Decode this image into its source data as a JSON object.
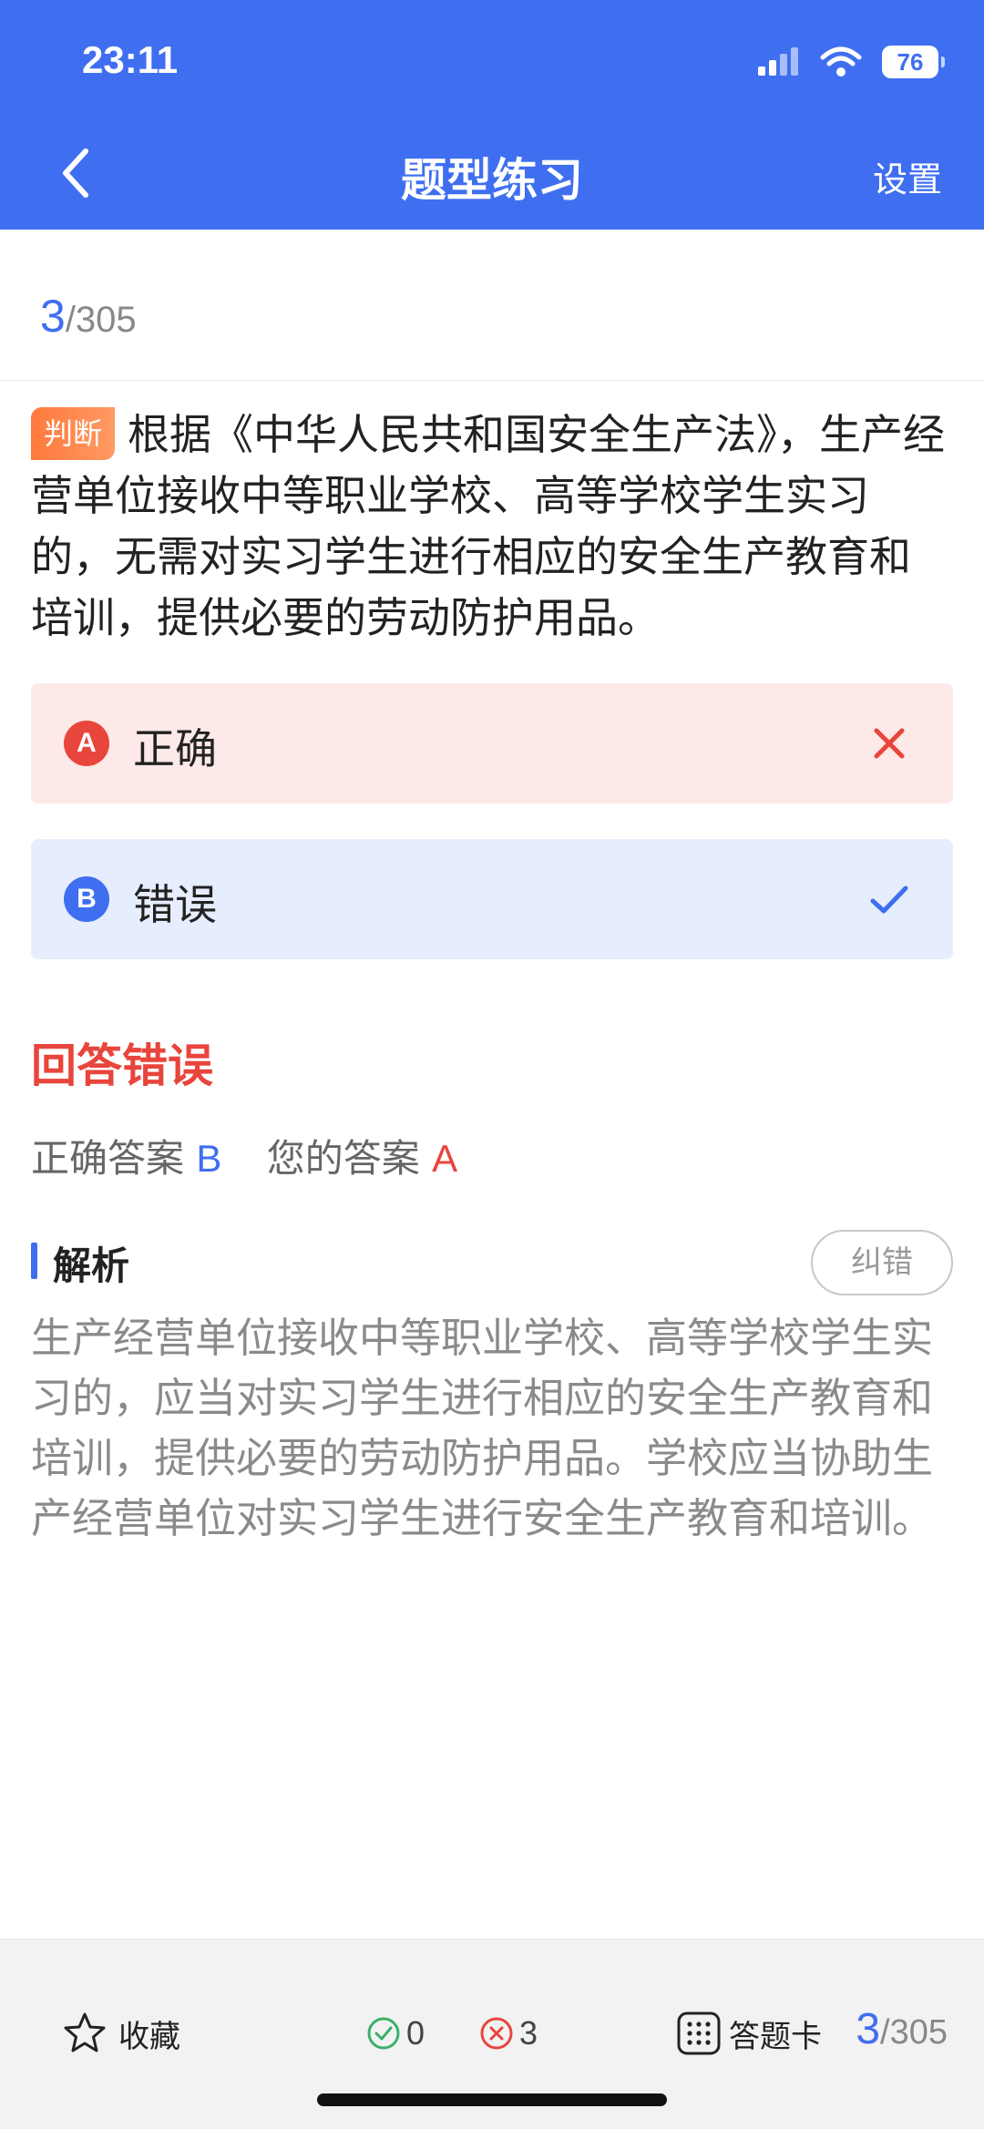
{
  "status_bar": {
    "time": "23:11",
    "battery": "76"
  },
  "nav": {
    "title": "题型练习",
    "settings_label": "设置"
  },
  "progress": {
    "current": "3",
    "total": "/305"
  },
  "question": {
    "type_tag": "判断",
    "text": "根据《中华人民共和国安全生产法》，生产经营单位接收中等职业学校、高等学校学生实习的，无需对实习学生进行相应的安全生产教育和培训，提供必要的劳动防护用品。"
  },
  "options": [
    {
      "letter": "A",
      "text": "正确",
      "state": "wrong"
    },
    {
      "letter": "B",
      "text": "错误",
      "state": "correct"
    }
  ],
  "result": {
    "title": "回答错误",
    "correct_label": "正确答案",
    "correct_value": "B",
    "your_label": "您的答案",
    "your_value": "A"
  },
  "analysis": {
    "title": "解析",
    "report_button": "纠错",
    "text": "生产经营单位接收中等职业学校、高等学校学生实习的，应当对实习学生进行相应的安全生产教育和培训，提供必要的劳动防护用品。学校应当协助生产经营单位对实习学生进行安全生产教育和培训。"
  },
  "bottom_bar": {
    "favorite_label": "收藏",
    "correct_count": "0",
    "wrong_count": "3",
    "card_label": "答题卡",
    "progress_current": "3",
    "progress_total": "/305"
  },
  "colors": {
    "primary": "#3f6ff0",
    "error": "#e8453c",
    "success": "#3bb06a",
    "tag_orange": "#ff7a3d"
  },
  "icons": [
    "back-icon",
    "signal-icon",
    "wifi-icon",
    "battery-icon",
    "wrong-x-icon",
    "check-icon",
    "star-icon",
    "correct-circle-icon",
    "wrong-circle-icon",
    "grid-icon"
  ]
}
